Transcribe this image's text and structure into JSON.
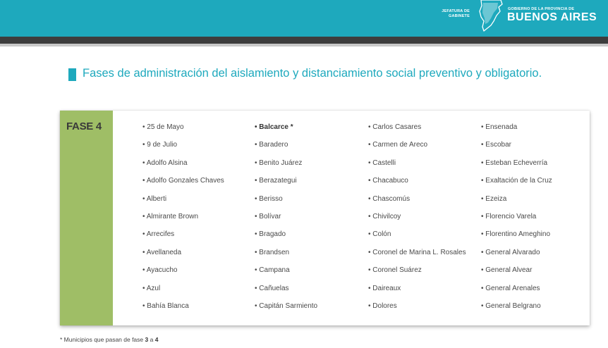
{
  "header": {
    "jefatura_line1": "JEFATURA DE",
    "jefatura_line2": "GABINETE",
    "gba_small": "GOBIERNO DE LA PROVINCIA DE",
    "gba_big": "BUENOS AIRES",
    "bar_color": "#1ea9bd"
  },
  "title": "Fases de administración del aislamiento y distanciamiento social preventivo y obligatorio.",
  "phase": {
    "label": "FASE 4",
    "color": "#9fbe66"
  },
  "columns": [
    [
      "• 25 de Mayo",
      "• 9 de Julio",
      "• Adolfo Alsina",
      "• Adolfo Gonzales Chaves",
      "• Alberti",
      "• Almirante Brown",
      "• Arrecifes",
      "• Avellaneda",
      "• Ayacucho",
      "• Azul",
      "• Bahía Blanca"
    ],
    [
      "• Balcarce *",
      "• Baradero",
      "• Benito Juárez",
      "• Berazategui",
      "• Berisso",
      "• Bolívar",
      "• Bragado",
      "• Brandsen",
      "• Campana",
      "• Cañuelas",
      "• Capitán Sarmiento"
    ],
    [
      "• Carlos Casares",
      "• Carmen de Areco",
      "• Castelli",
      "• Chacabuco",
      "• Chascomús",
      "• Chivilcoy",
      "• Colón",
      "• Coronel de Marina L. Rosales",
      "• Coronel Suárez",
      "• Daireaux",
      "• Dolores"
    ],
    [
      "• Ensenada",
      "• Escobar",
      "• Esteban Echeverría",
      "• Exaltación de la Cruz",
      "• Ezeiza",
      "• Florencio Varela",
      "• Florentino Ameghino",
      "• General Alvarado",
      "• General Alvear",
      "• General Arenales",
      "• General Belgrano"
    ]
  ],
  "footnote": {
    "star": "*",
    "text_before": " Municipios que pasan de fase ",
    "from": "3",
    "middle": " a ",
    "to": "4"
  }
}
